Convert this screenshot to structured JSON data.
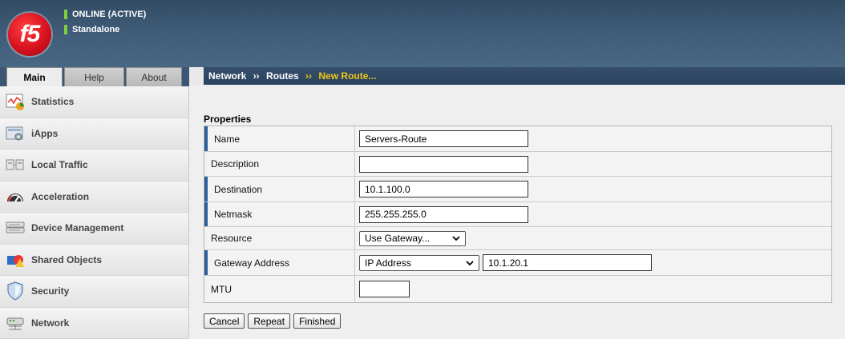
{
  "header": {
    "logo_text": "f5",
    "status_line_1": "ONLINE (ACTIVE)",
    "status_line_2": "Standalone",
    "status_color": "#7bd23d"
  },
  "tabs": [
    {
      "label": "Main",
      "active": true
    },
    {
      "label": "Help",
      "active": false
    },
    {
      "label": "About",
      "active": false
    }
  ],
  "breadcrumb": {
    "part_1": "Network",
    "sep": "››",
    "part_2": "Routes",
    "current": "New Route..."
  },
  "sidebar": {
    "items": [
      {
        "label": "Statistics",
        "icon": "statistics-icon"
      },
      {
        "label": "iApps",
        "icon": "iapps-icon"
      },
      {
        "label": "Local Traffic",
        "icon": "local-traffic-icon"
      },
      {
        "label": "Acceleration",
        "icon": "speedometer-icon"
      },
      {
        "label": "Device Management",
        "icon": "device-icon"
      },
      {
        "label": "Shared Objects",
        "icon": "shared-objects-icon"
      },
      {
        "label": "Security",
        "icon": "shield-icon"
      },
      {
        "label": "Network",
        "icon": "network-icon"
      }
    ]
  },
  "form": {
    "section_title": "Properties",
    "name": {
      "label": "Name",
      "value": "Servers-Route"
    },
    "description": {
      "label": "Description",
      "value": ""
    },
    "destination": {
      "label": "Destination",
      "value": "10.1.100.0"
    },
    "netmask": {
      "label": "Netmask",
      "value": "255.255.255.0"
    },
    "resource": {
      "label": "Resource",
      "selected": "Use Gateway..."
    },
    "gateway": {
      "label": "Gateway Address",
      "type_selected": "IP Address",
      "value": "10.1.20.1"
    },
    "mtu": {
      "label": "MTU",
      "value": ""
    }
  },
  "buttons": {
    "cancel": "Cancel",
    "repeat": "Repeat",
    "finished": "Finished"
  },
  "colors": {
    "required_marker": "#2b5d9a",
    "breadcrumb_current": "#f0c419"
  }
}
